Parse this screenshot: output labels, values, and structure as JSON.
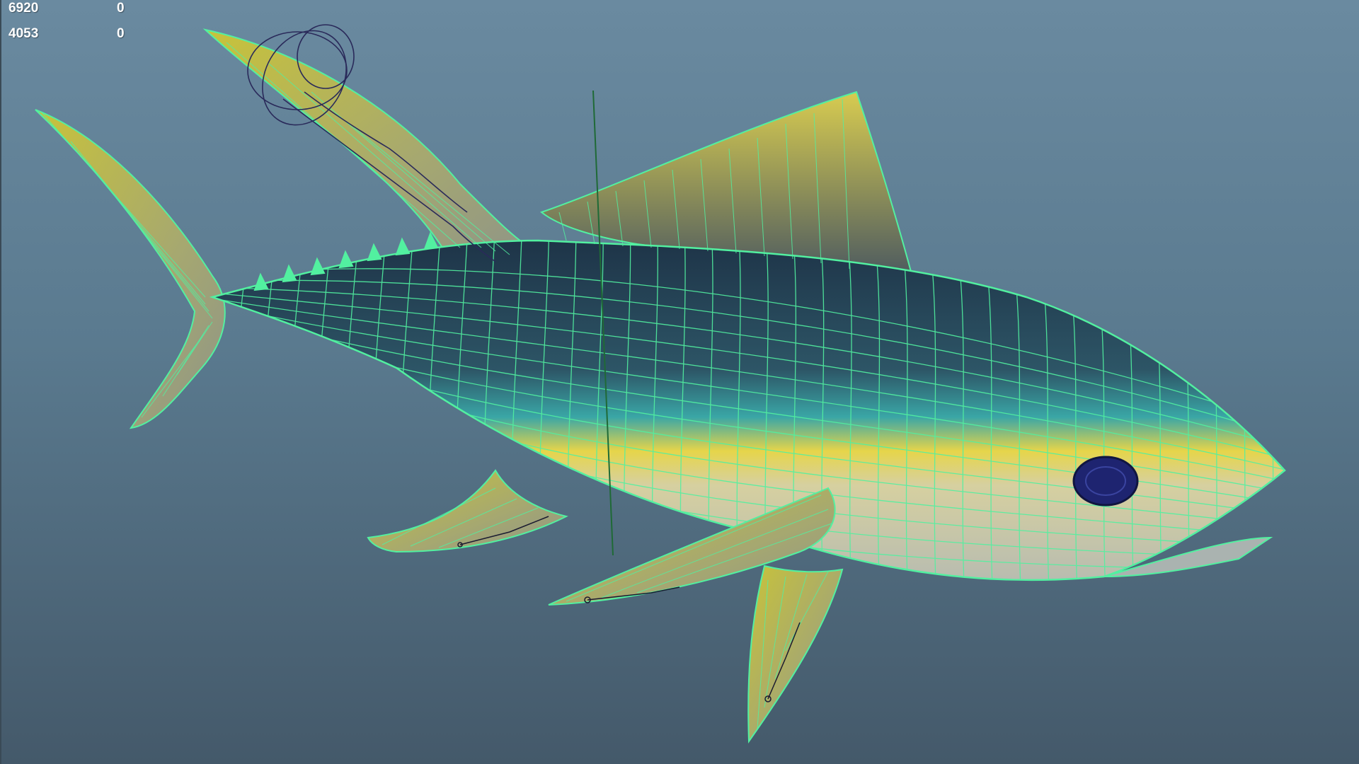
{
  "hud": {
    "rows": [
      {
        "label": "6920",
        "value": "0"
      },
      {
        "label": "4053",
        "value": "0"
      }
    ]
  },
  "scene": {
    "background_top": "#6a8aa0",
    "background_bottom": "#44596a",
    "wireframe_color": "#52f0a0",
    "joint_curve_color": "#2a2a5a",
    "model_icon": "yellowfin-tuna-model"
  }
}
